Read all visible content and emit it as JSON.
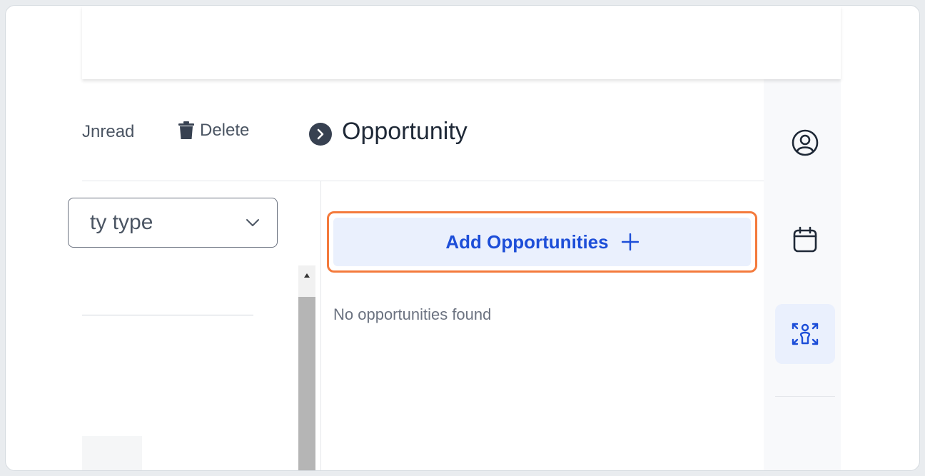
{
  "toolbar": {
    "unread_label": "Jnread",
    "delete_label": "Delete"
  },
  "filter": {
    "selected_value": "ty type"
  },
  "opportunity_panel": {
    "title": "Opportunity",
    "add_button_label": "Add Opportunities",
    "empty_message": "No opportunities found"
  },
  "right_rail": {
    "items": [
      {
        "icon": "user-circle-icon"
      },
      {
        "icon": "calendar-icon"
      },
      {
        "icon": "opportunities-icon",
        "active": true
      }
    ]
  },
  "colors": {
    "accent_blue": "#1d4ed8",
    "highlight_orange": "#f47a3c",
    "button_bg": "#eaf0fd"
  }
}
